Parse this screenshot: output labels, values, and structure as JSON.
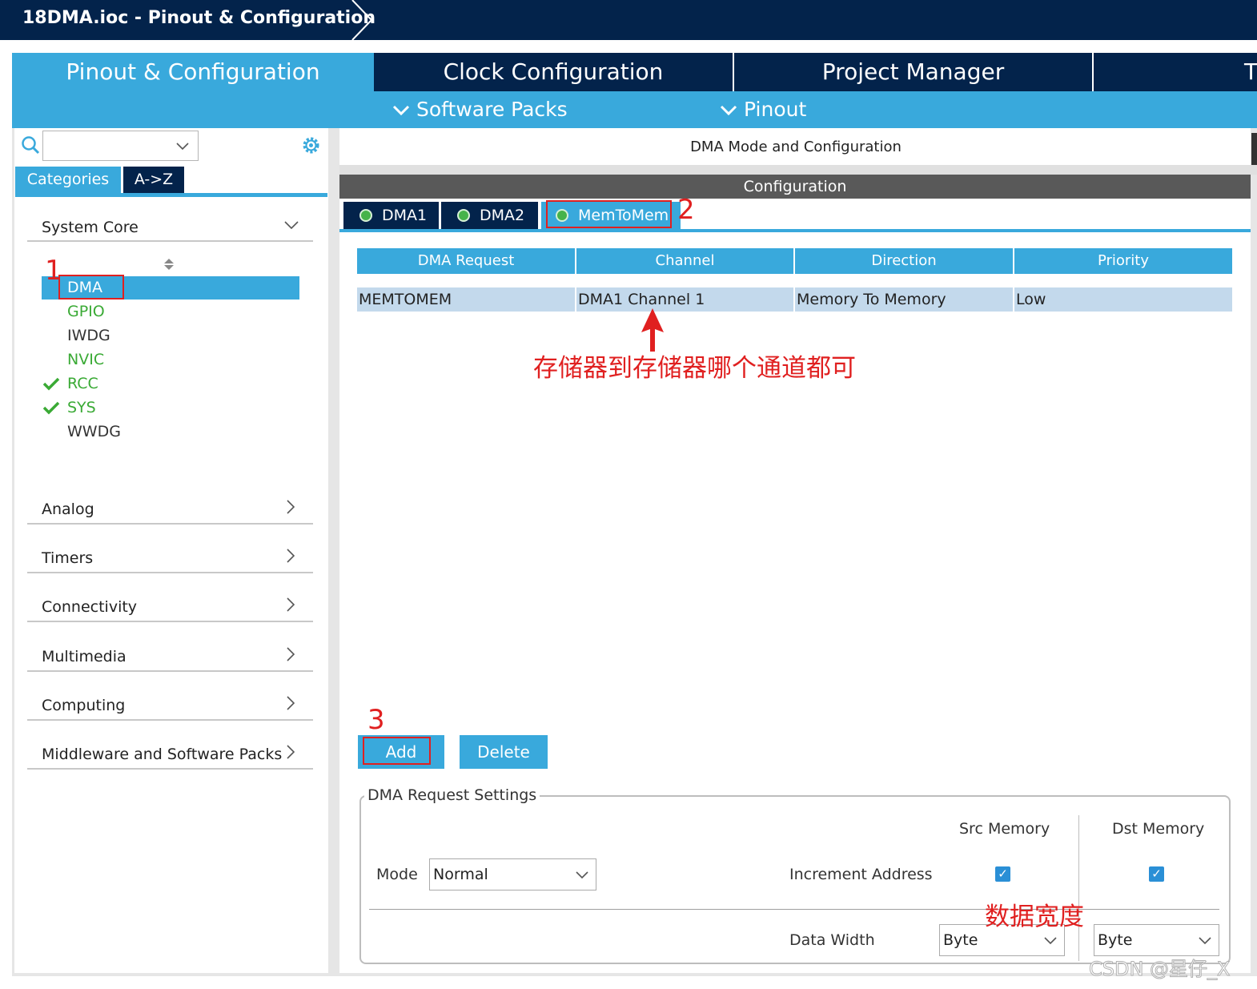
{
  "window": {
    "title": "18DMA.ioc - Pinout & Configuration"
  },
  "main_tabs": [
    {
      "label": "Pinout & Configuration"
    },
    {
      "label": "Clock Configuration"
    },
    {
      "label": "Project Manager"
    },
    {
      "label": "T"
    }
  ],
  "sub_menu": {
    "software_packs": "Software Packs",
    "pinout": "Pinout"
  },
  "left": {
    "search_value": "",
    "tab_categories": "Categories",
    "tab_az": "A->Z",
    "system_core": "System Core",
    "items": [
      {
        "label": "DMA",
        "selected": true,
        "checked": false
      },
      {
        "label": "GPIO",
        "checked": false
      },
      {
        "label": "IWDG",
        "checked": false
      },
      {
        "label": "NVIC",
        "checked": false
      },
      {
        "label": "RCC",
        "checked": true
      },
      {
        "label": "SYS",
        "checked": true
      },
      {
        "label": "WWDG",
        "checked": false
      }
    ],
    "categories": [
      "Analog",
      "Timers",
      "Connectivity",
      "Multimedia",
      "Computing",
      "Middleware and Software Packs"
    ]
  },
  "right": {
    "mode_header": "DMA Mode and Configuration",
    "config_header": "Configuration",
    "dma_tabs": [
      "DMA1",
      "DMA2",
      "MemToMem"
    ],
    "table_headers": [
      "DMA Request",
      "Channel",
      "Direction",
      "Priority"
    ],
    "table_rows": [
      {
        "request": "MEMTOMEM",
        "channel": "DMA1 Channel 1",
        "direction": "Memory To Memory",
        "priority": "Low"
      }
    ],
    "add_label": "Add",
    "delete_label": "Delete",
    "settings": {
      "legend": "DMA Request Settings",
      "src_memory": "Src Memory",
      "dst_memory": "Dst Memory",
      "mode_label": "Mode",
      "mode_value": "Normal",
      "increment_label": "Increment Address",
      "src_increment": true,
      "dst_increment": true,
      "data_width_label": "Data Width",
      "src_width": "Byte",
      "dst_width": "Byte"
    }
  },
  "annotations": {
    "n1": "1",
    "n2": "2",
    "n3": "3",
    "note_channel": "存储器到存储器哪个通道都可",
    "note_width": "数据宽度",
    "watermark": "CSDN @星仔_X"
  },
  "colors": {
    "navy": "#03234b",
    "accent_blue": "#39a9dc",
    "annotation_red": "#e02020",
    "check_green": "#3aaa35"
  }
}
